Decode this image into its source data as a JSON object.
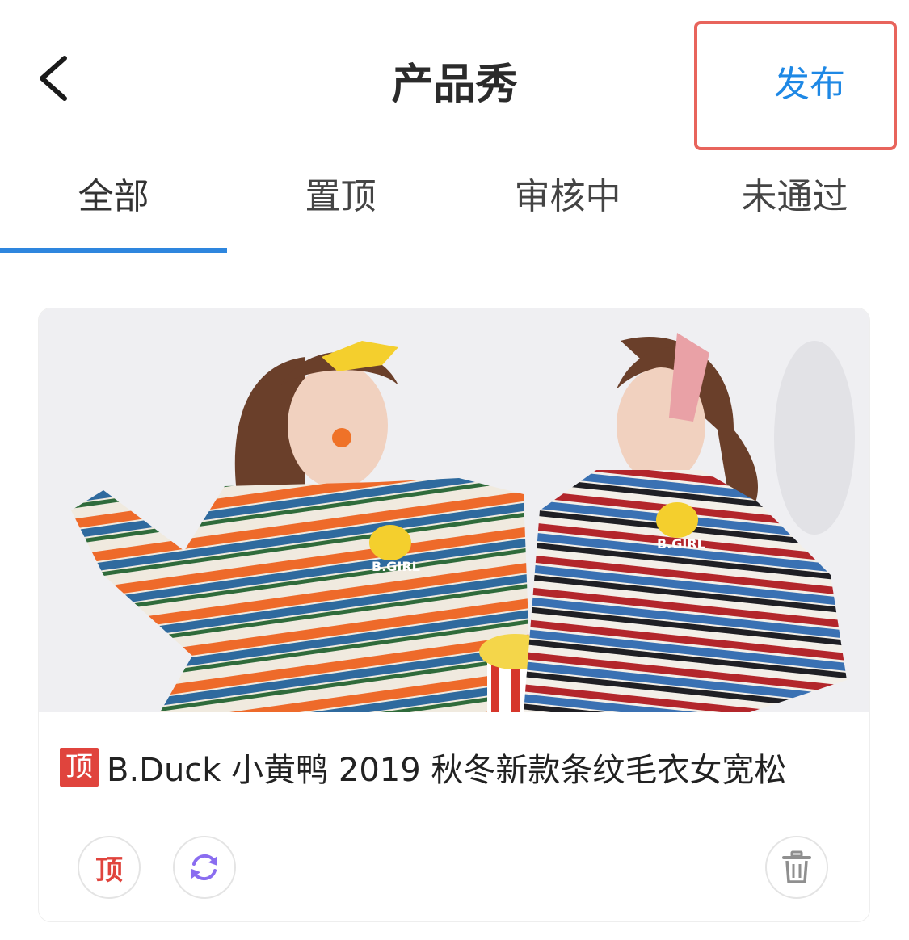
{
  "header": {
    "title": "产品秀",
    "publish_label": "发布"
  },
  "tabs": [
    {
      "label": "全部",
      "active": true
    },
    {
      "label": "置顶",
      "active": false
    },
    {
      "label": "审核中",
      "active": false
    },
    {
      "label": "未通过",
      "active": false
    }
  ],
  "card": {
    "badge": "顶",
    "title": "B.Duck 小黄鸭 2019 秋冬新款条纹毛衣女宽松",
    "photo_shirt_text_left": "B.GIRL",
    "photo_shirt_text_right": "B.GIRL",
    "actions": {
      "pin_label": "顶",
      "refresh_icon": "refresh-icon",
      "delete_icon": "trash-icon"
    }
  },
  "colors": {
    "accent": "#1e88e5",
    "tab_underline": "#2e86de",
    "badge_red": "#e0443d",
    "refresh_purple": "#8a6df0",
    "highlight": "#e8645c"
  }
}
